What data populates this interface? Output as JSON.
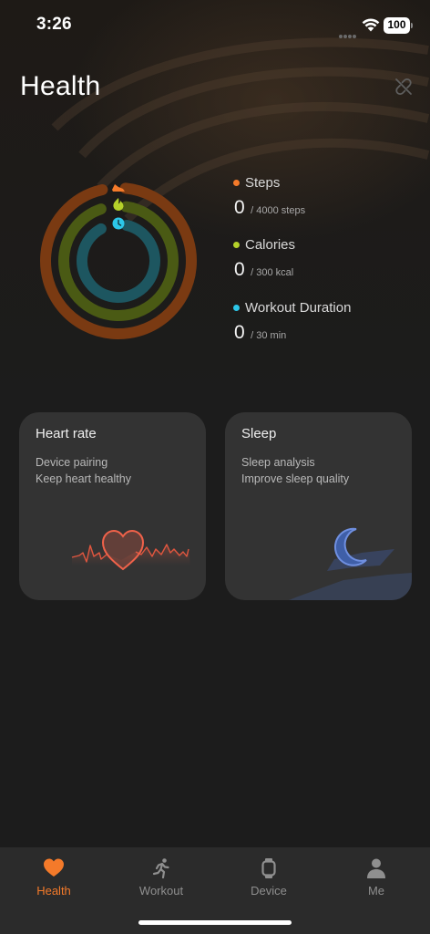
{
  "status_bar": {
    "time": "3:26",
    "battery": "100"
  },
  "header": {
    "title": "Health",
    "link_icon": "unlink-icon"
  },
  "activity": {
    "rings": [
      {
        "name": "steps",
        "color": "#7a3a12",
        "icon": "sneaker-icon",
        "icon_color": "#f47a2a",
        "progress": 0
      },
      {
        "name": "calories",
        "color": "#4a5a14",
        "icon": "flame-icon",
        "icon_color": "#b5d12a",
        "progress": 0
      },
      {
        "name": "workout",
        "color": "#1d5660",
        "icon": "clock-icon",
        "icon_color": "#2cc6e8",
        "progress": 0
      }
    ],
    "stats": [
      {
        "label": "Steps",
        "value": "0",
        "goal": "/ 4000 steps",
        "color": "#f47a2a"
      },
      {
        "label": "Calories",
        "value": "0",
        "goal": "/ 300 kcal",
        "color": "#b5d12a"
      },
      {
        "label": "Workout Duration",
        "value": "0",
        "goal": "/ 30 min",
        "color": "#2cc6e8"
      }
    ]
  },
  "cards": {
    "heart_rate": {
      "title": "Heart rate",
      "line1": "Device pairing",
      "line2": "Keep heart healthy",
      "icon": "heart-icon",
      "accent": "#f0624a"
    },
    "sleep": {
      "title": "Sleep",
      "line1": "Sleep analysis",
      "line2": "Improve sleep quality",
      "icon": "moon-icon",
      "accent": "#6f8fe0"
    }
  },
  "tab_bar": {
    "active_color": "#f47a2a",
    "tabs": [
      {
        "label": "Health",
        "icon": "heart-icon",
        "active": true
      },
      {
        "label": "Workout",
        "icon": "running-icon",
        "active": false
      },
      {
        "label": "Device",
        "icon": "watch-icon",
        "active": false
      },
      {
        "label": "Me",
        "icon": "person-icon",
        "active": false
      }
    ]
  }
}
